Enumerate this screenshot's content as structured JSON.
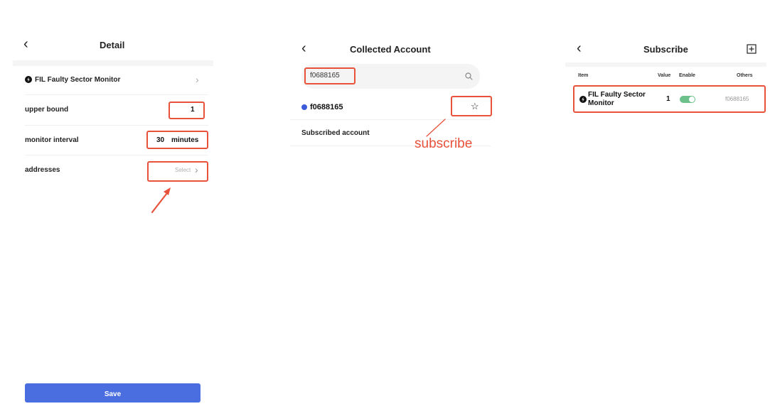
{
  "panel1": {
    "title": "Detail",
    "monitor_name": "FIL Faulty Sector Monitor",
    "upper_bound_label": "upper bound",
    "upper_bound_value": "1",
    "interval_label": "monitor interval",
    "interval_value": "30",
    "interval_unit": "minutes",
    "addresses_label": "addresses",
    "addresses_placeholder": "Select",
    "save_label": "Save"
  },
  "panel2": {
    "title": "Collected Account",
    "search_value": "f0688165",
    "account": "f0688165",
    "subscribed_label": "Subscribed account",
    "annotation": "subscribe"
  },
  "panel3": {
    "title": "Subscribe",
    "columns": {
      "item": "Item",
      "value": "Value",
      "enable": "Enable",
      "others": "Others"
    },
    "row": {
      "item_line1": "FIL Faulty Sector",
      "item_line2": "Monitor",
      "value": "1",
      "enabled": true,
      "others": "f0688165"
    }
  },
  "colors": {
    "accent": "#4a6ee0",
    "annotation": "#e8523a",
    "toggle_on": "#6cc08a",
    "dot": "#3b5bdb"
  },
  "icons": [
    "chevron-left-icon",
    "chevron-right-icon",
    "search-icon",
    "star-icon",
    "plus-square-icon",
    "monitor-icon",
    "toggle-switch",
    "arrow-icon"
  ]
}
